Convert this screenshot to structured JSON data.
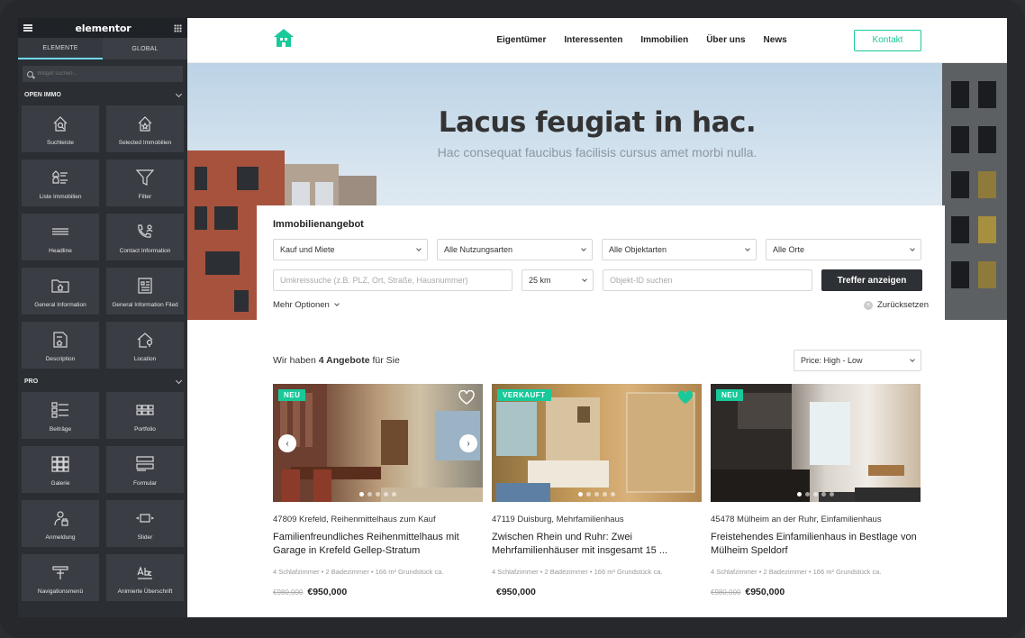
{
  "editor": {
    "brand": "elementor",
    "tabs": [
      "ELEMENTE",
      "GLOBAL"
    ],
    "search_placeholder": "Widget suchen...",
    "sections": [
      {
        "title": "OPEN IMMO",
        "widgets": [
          {
            "label": "Suchleiste",
            "icon": "house-search-icon"
          },
          {
            "label": "Selected Immobilien",
            "icon": "house-star-icon"
          },
          {
            "label": "Liste Immobilien",
            "icon": "house-list-icon"
          },
          {
            "label": "Filter",
            "icon": "filter-icon"
          },
          {
            "label": "Headline",
            "icon": "headline-icon"
          },
          {
            "label": "Contact Information",
            "icon": "phone-user-icon"
          },
          {
            "label": "General Information",
            "icon": "folder-house-icon"
          },
          {
            "label": "General Information Filed",
            "icon": "document-list-icon"
          },
          {
            "label": "Description",
            "icon": "description-icon"
          },
          {
            "label": "Location",
            "icon": "house-location-icon"
          }
        ]
      },
      {
        "title": "PRO",
        "widgets": [
          {
            "label": "Beiträge",
            "icon": "posts-icon"
          },
          {
            "label": "Portfolio",
            "icon": "portfolio-icon"
          },
          {
            "label": "Galerie",
            "icon": "gallery-icon"
          },
          {
            "label": "Formular",
            "icon": "form-icon"
          },
          {
            "label": "Anmeldung",
            "icon": "login-icon"
          },
          {
            "label": "Slider",
            "icon": "slider-icon"
          },
          {
            "label": "Navigationsmenü",
            "icon": "nav-menu-icon"
          },
          {
            "label": "Animierte Überschrift",
            "icon": "animated-headline-icon"
          }
        ]
      }
    ]
  },
  "site": {
    "nav": [
      "Eigentümer",
      "Interessenten",
      "Immobilien",
      "Über uns",
      "News"
    ],
    "contact_button": "Kontakt",
    "hero_title": "Lacus feugiat in hac.",
    "hero_subtitle": "Hac consequat faucibus facilisis cursus amet morbi nulla.",
    "search": {
      "title": "Immobilienangebot",
      "selects": [
        "Kauf und Miete",
        "Alle Nutzungsarten",
        "Alle Objektarten",
        "Alle Orte"
      ],
      "radius_placeholder": "Umkreissuche (z.B. PLZ, Ort, Straße, Hausnummer)",
      "distance": "25 km",
      "id_placeholder": "Objekt-ID suchen",
      "submit": "Treffer anzeigen",
      "more_options": "Mehr Optionen",
      "reset": "Zurücksetzen"
    },
    "results": {
      "prefix": "Wir haben ",
      "count": "4 Angebote",
      "suffix": " für Sie",
      "sort": "Price: High - Low"
    },
    "listings": [
      {
        "badge": "NEU",
        "favorite": false,
        "location": "47809 Krefeld, Reihenmittelhaus zum Kauf",
        "title": "Familienfreundliches Reihenmittelhaus mit Garage in Krefeld Gellep-Stratum",
        "features": "4 Schlafzimmer • 2 Badezimmer • 166 m² Grundstück ca.",
        "old_price": "€980,000",
        "price": "€950,000"
      },
      {
        "badge": "VERKAUFT",
        "favorite": true,
        "location": "47119 Duisburg, Mehrfamilienhaus",
        "title": "Zwischen Rhein und Ruhr: Zwei Mehrfamilienhäuser mit insgesamt 15 ...",
        "features": "4 Schlafzimmer • 2 Badezimmer • 166 m² Grundstück ca.",
        "old_price": "",
        "price": "€950,000"
      },
      {
        "badge": "NEU",
        "favorite": false,
        "location": "45478 Mülheim an der Ruhr, Einfamilienhaus",
        "title": "Freistehendes Einfamilienhaus in Bestlage von Mülheim Speldorf",
        "features": "4 Schlafzimmer • 2 Badezimmer • 166 m² Grundstück ca.",
        "old_price": "€980,000",
        "price": "€950,000"
      }
    ],
    "colors": {
      "accent": "#19c99a",
      "dark_button": "#2d3034"
    }
  }
}
